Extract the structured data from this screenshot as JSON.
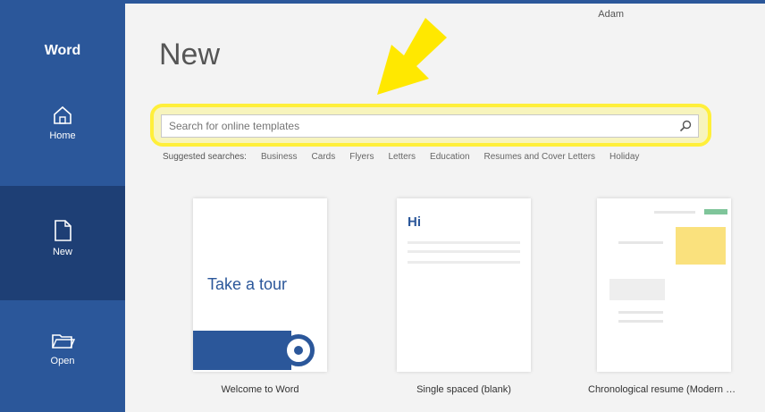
{
  "app": {
    "name": "Word"
  },
  "sidebar": {
    "items": [
      {
        "label": "Home",
        "icon": "home-icon"
      },
      {
        "label": "New",
        "icon": "new-document-icon"
      },
      {
        "label": "Open",
        "icon": "open-folder-icon"
      }
    ]
  },
  "header": {
    "account_name": "Adam"
  },
  "page": {
    "title": "New"
  },
  "search": {
    "placeholder": "Search for online templates",
    "value": ""
  },
  "suggested": {
    "label": "Suggested searches:",
    "links": [
      "Business",
      "Cards",
      "Flyers",
      "Letters",
      "Education",
      "Resumes and Cover Letters",
      "Holiday"
    ]
  },
  "templates": [
    {
      "name": "Welcome to Word",
      "preview_text": "Take a tour"
    },
    {
      "name": "Single spaced (blank)",
      "preview_text": "Hi"
    },
    {
      "name": "Chronological resume (Modern design)"
    }
  ],
  "colors": {
    "brand": "#2b579a",
    "brand_dark": "#1e3f75",
    "highlight": "#ffef3a"
  }
}
